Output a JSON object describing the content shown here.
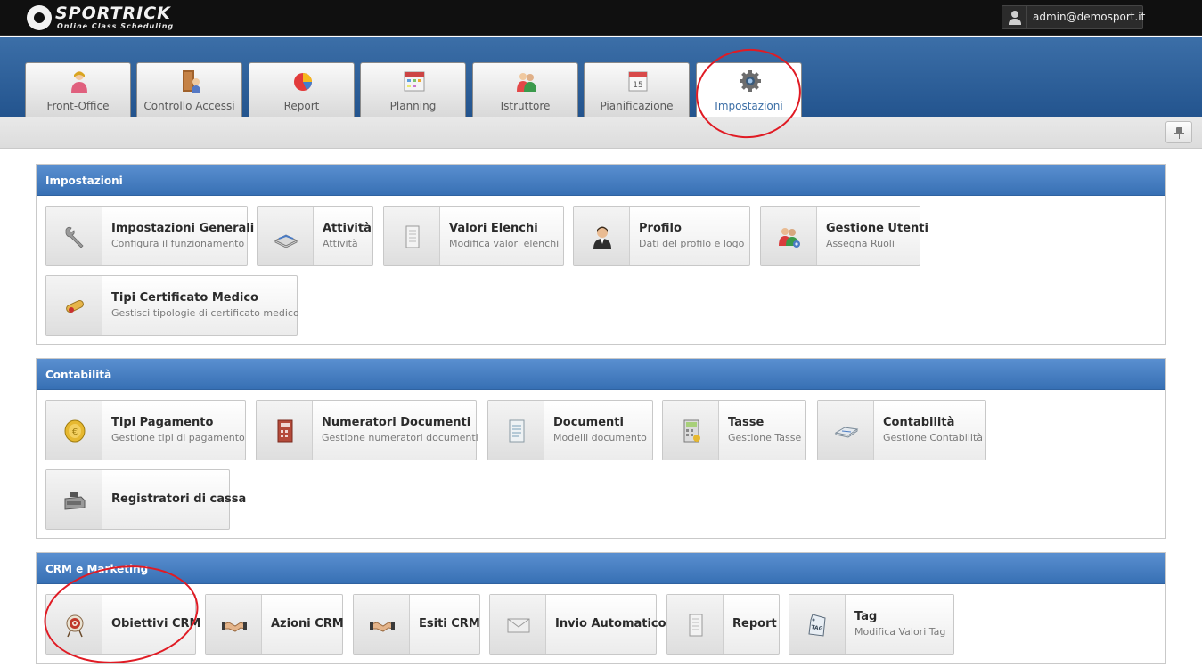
{
  "app": {
    "logo_name": "SPORTRICK",
    "logo_tagline": "Online Class Scheduling",
    "user_email": "admin@demosport.it"
  },
  "tabs": [
    {
      "label": "Front-Office",
      "icon": "front-office-icon"
    },
    {
      "label": "Controllo Accessi",
      "icon": "door-access-icon"
    },
    {
      "label": "Report",
      "icon": "pie-chart-icon"
    },
    {
      "label": "Planning",
      "icon": "calendar-grid-icon"
    },
    {
      "label": "Istruttore",
      "icon": "instructor-icon"
    },
    {
      "label": "Pianificazione",
      "icon": "calendar-day-icon",
      "day": "15"
    },
    {
      "label": "Impostazioni",
      "icon": "settings-gear-icon",
      "active": true
    }
  ],
  "sections": [
    {
      "title": "Impostazioni",
      "cards": [
        {
          "title": "Impostazioni Generali",
          "subtitle": "Configura il funzionamento",
          "icon": "wrench-icon"
        },
        {
          "title": "Attività",
          "subtitle": "Attività",
          "icon": "book-icon"
        },
        {
          "title": "Valori Elenchi",
          "subtitle": "Modifica valori elenchi",
          "icon": "list-document-icon"
        },
        {
          "title": "Profilo",
          "subtitle": "Dati del profilo e logo",
          "icon": "profile-person-icon"
        },
        {
          "title": "Gestione Utenti",
          "subtitle": "Assegna Ruoli",
          "icon": "users-gear-icon"
        },
        {
          "title": "Tipi Certificato Medico",
          "subtitle": "Gestisci tipologie di certificato medico",
          "icon": "scroll-certificate-icon"
        }
      ]
    },
    {
      "title": "Contabilità",
      "cards": [
        {
          "title": "Tipi Pagamento",
          "subtitle": "Gestione tipi di pagamento",
          "icon": "coin-icon"
        },
        {
          "title": "Numeratori Documenti",
          "subtitle": "Gestione numeratori documenti",
          "icon": "numbered-document-icon"
        },
        {
          "title": "Documenti",
          "subtitle": "Modelli documento",
          "icon": "document-icon"
        },
        {
          "title": "Tasse",
          "subtitle": "Gestione Tasse",
          "icon": "calculator-icon"
        },
        {
          "title": "Contabilità",
          "subtitle": "Gestione Contabilità",
          "icon": "ledger-icon"
        },
        {
          "title": "Registratori di cassa",
          "subtitle": "",
          "icon": "cash-register-icon"
        }
      ]
    },
    {
      "title": "CRM e Marketing",
      "cards": [
        {
          "title": "Obiettivi CRM",
          "subtitle": "",
          "icon": "target-icon"
        },
        {
          "title": "Azioni CRM",
          "subtitle": "",
          "icon": "handshake-icon"
        },
        {
          "title": "Esiti CRM",
          "subtitle": "",
          "icon": "handshake-icon"
        },
        {
          "title": "Invio Automatico",
          "subtitle": "",
          "icon": "envelope-icon"
        },
        {
          "title": "Report",
          "subtitle": "",
          "icon": "report-document-icon"
        },
        {
          "title": "Tag",
          "subtitle": "Modifica Valori Tag",
          "icon": "tag-icon",
          "tag_text": "TAG"
        }
      ]
    }
  ],
  "colors": {
    "topbar": "#101010",
    "header_blue": "#2f62a0",
    "panel_header": "#4a82c4",
    "annotation_red": "#e01b24"
  }
}
